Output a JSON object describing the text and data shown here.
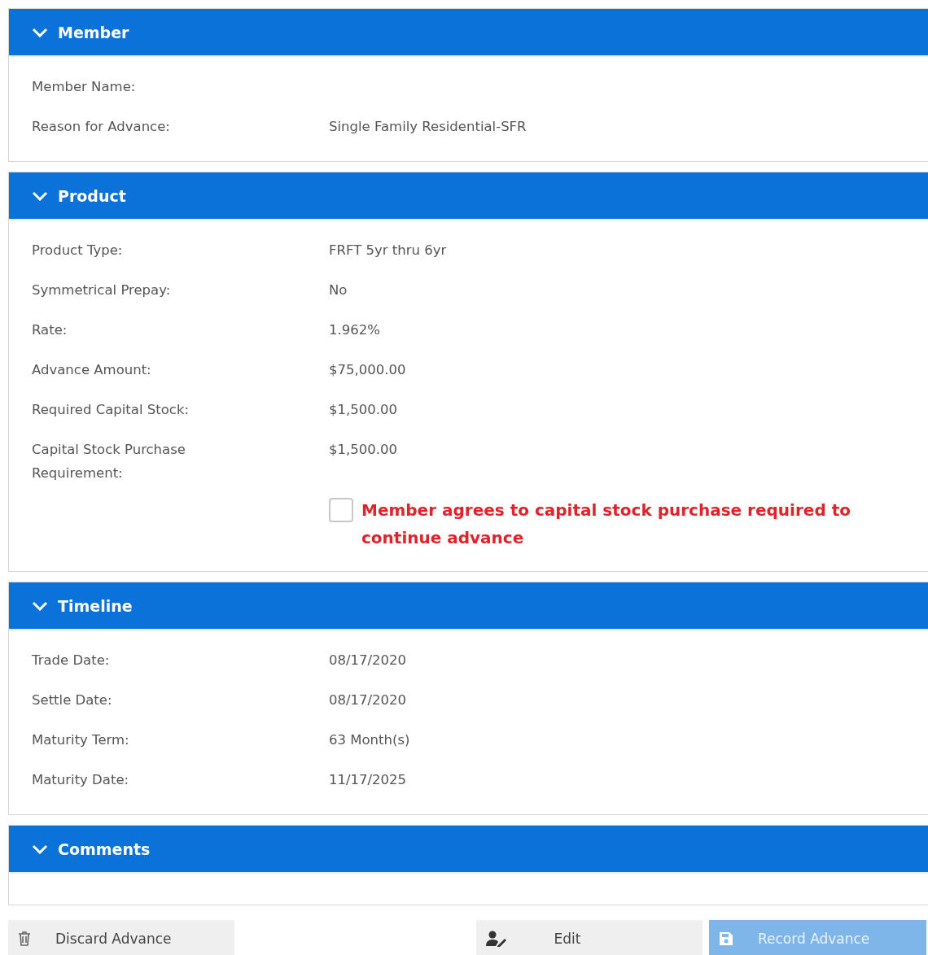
{
  "sections": [
    {
      "title": "Member",
      "expanded": true,
      "fields": [
        {
          "label": "Member Name:"
        },
        {
          "label": "Reason for Advance:",
          "value": "Single Family Residential-SFR"
        }
      ]
    },
    {
      "title": "Product",
      "expanded": true,
      "fields": [
        {
          "label": "Product Type:",
          "value": "FRFT 5yr thru 6yr"
        },
        {
          "label": "Symmetrical Prepay:",
          "value": "No"
        },
        {
          "label": "Rate:",
          "value": "1.962%"
        },
        {
          "label": "Advance Amount:",
          "value": "$75,000.00"
        },
        {
          "label": "Required Capital Stock:",
          "value": "$1,500.00"
        },
        {
          "label": "Capital Stock Purchase Requirement:",
          "value": "$1,500.00"
        }
      ],
      "agreement": {
        "label": "Member agrees to capital stock purchase required to continue advance",
        "checked": false
      }
    },
    {
      "title": "Timeline",
      "expanded": true,
      "fields": [
        {
          "label": "Trade Date:",
          "value": "08/17/2020"
        },
        {
          "label": "Settle Date:",
          "value": "08/17/2020"
        },
        {
          "label": "Maturity Term:",
          "value": "63 Month(s)"
        },
        {
          "label": "Maturity Date:",
          "value": "11/17/2025"
        }
      ]
    },
    {
      "title": "Comments",
      "expanded": true
    }
  ],
  "actions": [
    {
      "kind": "discard",
      "label": "Discard Advance",
      "disabled": false
    },
    {
      "kind": "edit",
      "label": "Edit",
      "disabled": false
    },
    {
      "kind": "record",
      "label": "Record Advance",
      "disabled": true
    }
  ]
}
